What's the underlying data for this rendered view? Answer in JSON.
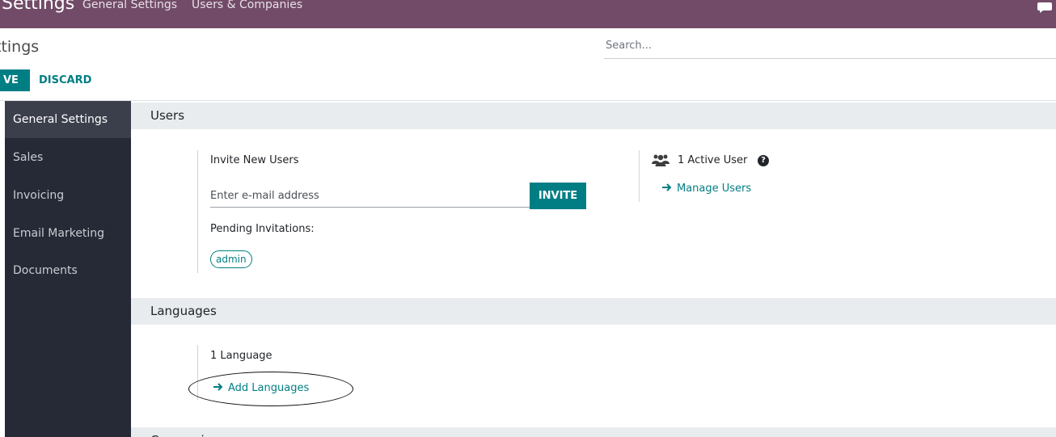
{
  "topbar": {
    "app_name": "Settings",
    "menu": [
      "General Settings",
      "Users & Companies"
    ],
    "chat_icon": "chat-icon",
    "bg_color": "#714b67"
  },
  "control_panel": {
    "breadcrumb": "ttings",
    "search_placeholder": "Search...",
    "save_label": "VE",
    "discard_label": "DISCARD"
  },
  "sidebar": {
    "items": [
      {
        "label": "General Settings",
        "active": true
      },
      {
        "label": "Sales"
      },
      {
        "label": "Invoicing"
      },
      {
        "label": "Email Marketing"
      },
      {
        "label": "Documents"
      }
    ]
  },
  "users_section": {
    "title": "Users",
    "invite_title": "Invite New Users",
    "email_placeholder": "Enter e-mail address",
    "invite_button": "INVITE",
    "pending_title": "Pending Invitations:",
    "pending": [
      "admin"
    ],
    "active_users": "1 Active User",
    "users_icon": "users-icon",
    "help_icon": "question-circle-icon",
    "manage_link": "Manage Users"
  },
  "languages_section": {
    "title": "Languages",
    "count": "1 Language",
    "add_link": "Add Languages"
  },
  "next_section": {
    "title": "Companies"
  },
  "colors": {
    "accent": "#017e84",
    "sidebar": "#262a36",
    "section_head": "#e9ecef"
  }
}
